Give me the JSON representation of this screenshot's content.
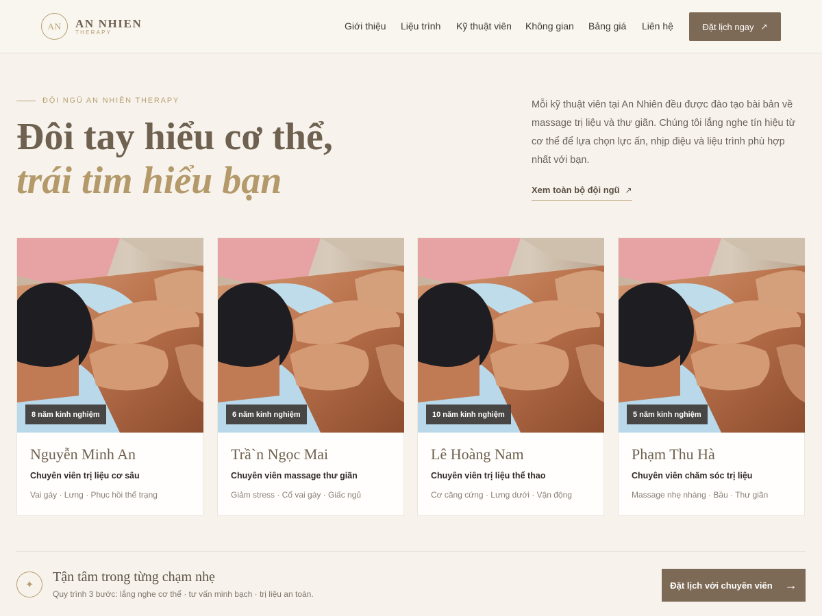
{
  "brand": {
    "mark": "AN",
    "name": "AN NHIEN",
    "sub": "THERAPY"
  },
  "nav": [
    {
      "label": "Giới thiệu"
    },
    {
      "label": "Liệu trình"
    },
    {
      "label": "Kỹ thuật viên"
    },
    {
      "label": "Không gian"
    },
    {
      "label": "Bảng giá"
    },
    {
      "label": "Liên hệ"
    }
  ],
  "header_cta": {
    "label": "Đặt lịch ngay",
    "icon": "arrow-up-right-icon"
  },
  "hero": {
    "eyebrow": "ĐỘI NGŨ AN NHIÊN THERAPY",
    "title_line1": "Đôi tay hiểu cơ thể,",
    "title_line2": "trái tim hiểu bạn",
    "intro": "Mỗi kỹ thuật viên tại An Nhiên đều được đào tạo bài bản về massage trị liệu và thư giãn. Chúng tôi lắng nghe tín hiệu từ cơ thể để lựa chọn lực ấn, nhịp điệu và liệu trình phù hợp nhất với bạn.",
    "link_label": "Xem toàn bộ đội ngũ"
  },
  "therapists": [
    {
      "badge": "8 năm kinh nghiệm",
      "name": "Nguyễn Minh An",
      "role": "Chuyên viên trị liệu cơ sâu",
      "tags": "Vai gáy · Lưng · Phục hồi thể trạng"
    },
    {
      "badge": "6 năm kinh nghiệm",
      "name": "Trầ`n Ngọc Mai",
      "role": "Chuyên viên massage thư giãn",
      "tags": "Giảm stress · Cổ vai gáy · Giấc ngủ"
    },
    {
      "badge": "10 năm kinh nghiệm",
      "name": "Lê Hoàng Nam",
      "role": "Chuyên viên trị liệu thể thao",
      "tags": "Cơ căng cứng · Lưng dưới · Vận động"
    },
    {
      "badge": "5 năm kinh nghiệm",
      "name": "Phạm Thu Hà",
      "role": "Chuyên viên chăm sóc trị liệu",
      "tags": "Massage nhẹ nhàng · Bầu · Thư giãn"
    }
  ],
  "footer": {
    "icon": "sparkle-icon",
    "title": "Tận tâm trong từng chạm nhẹ",
    "subtitle": "Quy trình 3 bước: lắng nghe cơ thể · tư vấn minh bạch · trị liệu an toàn.",
    "cta_label": "Đặt lịch với chuyên viên"
  },
  "colors": {
    "background": "#f7f3ec",
    "accent_brown": "#7d6a56",
    "accent_gold": "#b49a6a"
  }
}
